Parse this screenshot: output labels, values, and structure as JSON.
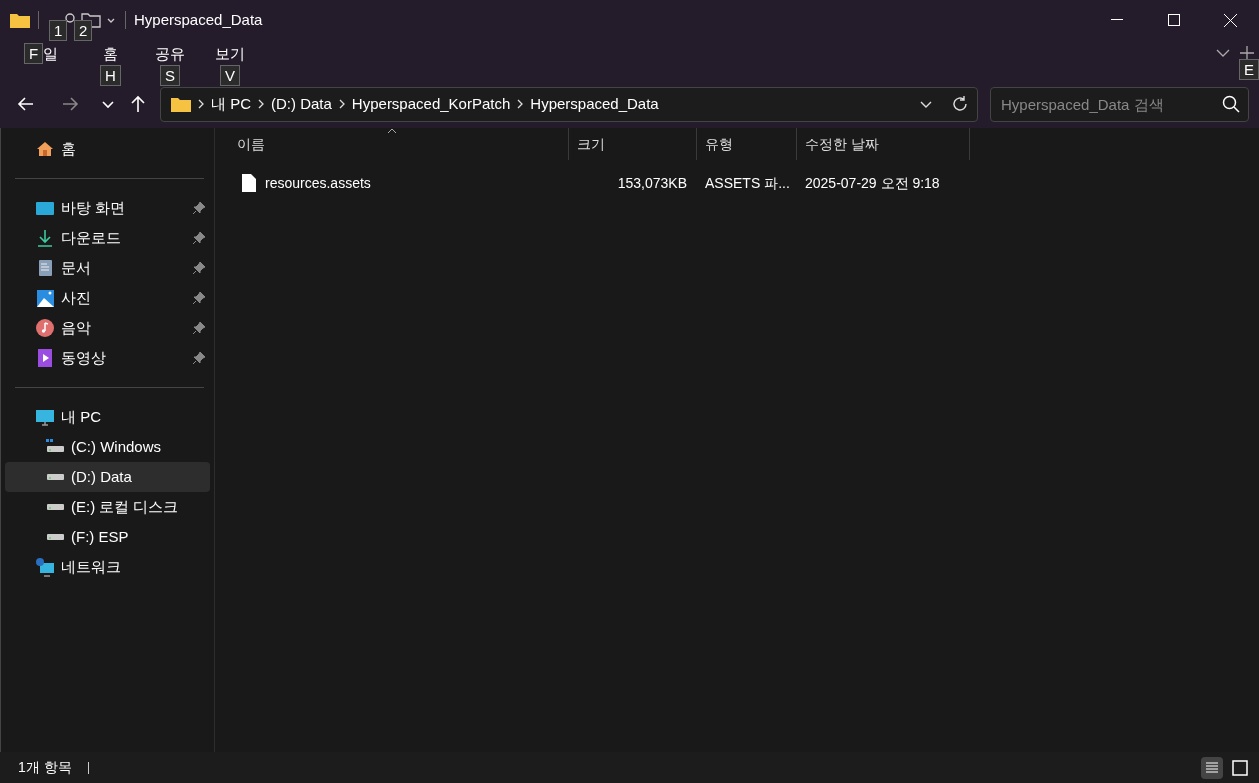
{
  "window": {
    "title": "Hyperspaced_Data"
  },
  "quick_access_keytips": [
    "1",
    "2"
  ],
  "menu": [
    {
      "label": "일",
      "keytip": "F"
    },
    {
      "label": "홈",
      "keytip": "H"
    },
    {
      "label": "공유",
      "keytip": "S"
    },
    {
      "label": "보기",
      "keytip": "V"
    }
  ],
  "ribbon_keytip": "E",
  "breadcrumb": [
    "내 PC",
    "(D:) Data",
    "Hyperspaced_KorPatch",
    "Hyperspaced_Data"
  ],
  "search": {
    "placeholder": "Hyperspaced_Data 검색"
  },
  "sidebar": {
    "groups": [
      [
        {
          "label": "홈",
          "kind": "home",
          "pinned": false,
          "selected": false
        }
      ],
      [
        {
          "label": "바탕 화면",
          "kind": "desktop",
          "pinned": true,
          "selected": false
        },
        {
          "label": "다운로드",
          "kind": "download",
          "pinned": true,
          "selected": false
        },
        {
          "label": "문서",
          "kind": "document",
          "pinned": true,
          "selected": false
        },
        {
          "label": "사진",
          "kind": "pictures",
          "pinned": true,
          "selected": false
        },
        {
          "label": "음악",
          "kind": "music",
          "pinned": true,
          "selected": false
        },
        {
          "label": "동영상",
          "kind": "video",
          "pinned": true,
          "selected": false
        }
      ],
      [
        {
          "label": "내 PC",
          "kind": "pc",
          "pinned": false,
          "selected": false,
          "children": [
            {
              "label": "(C:) Windows",
              "kind": "system-drive",
              "pinned": false,
              "selected": false
            },
            {
              "label": "(D:) Data",
              "kind": "drive",
              "pinned": false,
              "selected": true
            },
            {
              "label": "(E:) 로컬 디스크",
              "kind": "drive",
              "pinned": false,
              "selected": false
            },
            {
              "label": "(F:) ESP",
              "kind": "drive",
              "pinned": false,
              "selected": false
            }
          ]
        },
        {
          "label": "네트워크",
          "kind": "network",
          "pinned": false,
          "selected": false
        }
      ]
    ]
  },
  "table": {
    "columns": [
      "이름",
      "크기",
      "유형",
      "수정한 날짜"
    ],
    "rows": [
      {
        "name": "resources.assets",
        "size": "153,073KB",
        "type": "ASSETS 파...",
        "modified": "2025-07-29 오전 9:18",
        "selected": false
      }
    ]
  },
  "status_bar": {
    "text": "1개 항목",
    "view_buttons": [
      {
        "kind": "details",
        "selected": true
      },
      {
        "kind": "preview",
        "selected": false
      }
    ]
  }
}
